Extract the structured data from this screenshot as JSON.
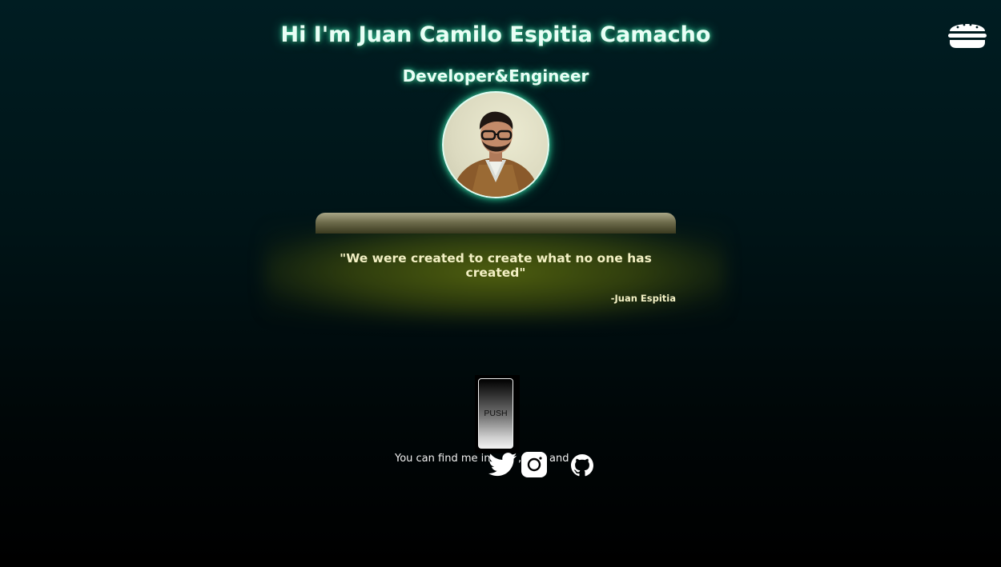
{
  "header": {
    "name": "Hi I'm Juan Camilo Espitia Camacho",
    "role": "Developer&Engineer",
    "menu_icon": "hamburger-menu-icon"
  },
  "profile": {
    "avatar_icon": "profile-photo"
  },
  "quote": {
    "text": "\"We were created to create what no one has created\"",
    "author": "-Juan Espitia"
  },
  "push_button": {
    "label": "PUSH"
  },
  "social": {
    "intro": "You can find me in",
    "separator": ",",
    "and": "and",
    "links": [
      {
        "icon": "twitter-icon"
      },
      {
        "icon": "instagram-icon"
      },
      {
        "icon": "github-icon"
      }
    ]
  },
  "colors": {
    "heading_glow": "#3fd7a4",
    "quote_glow": "#6c7c0e",
    "quote_text": "#f3f0c4"
  }
}
